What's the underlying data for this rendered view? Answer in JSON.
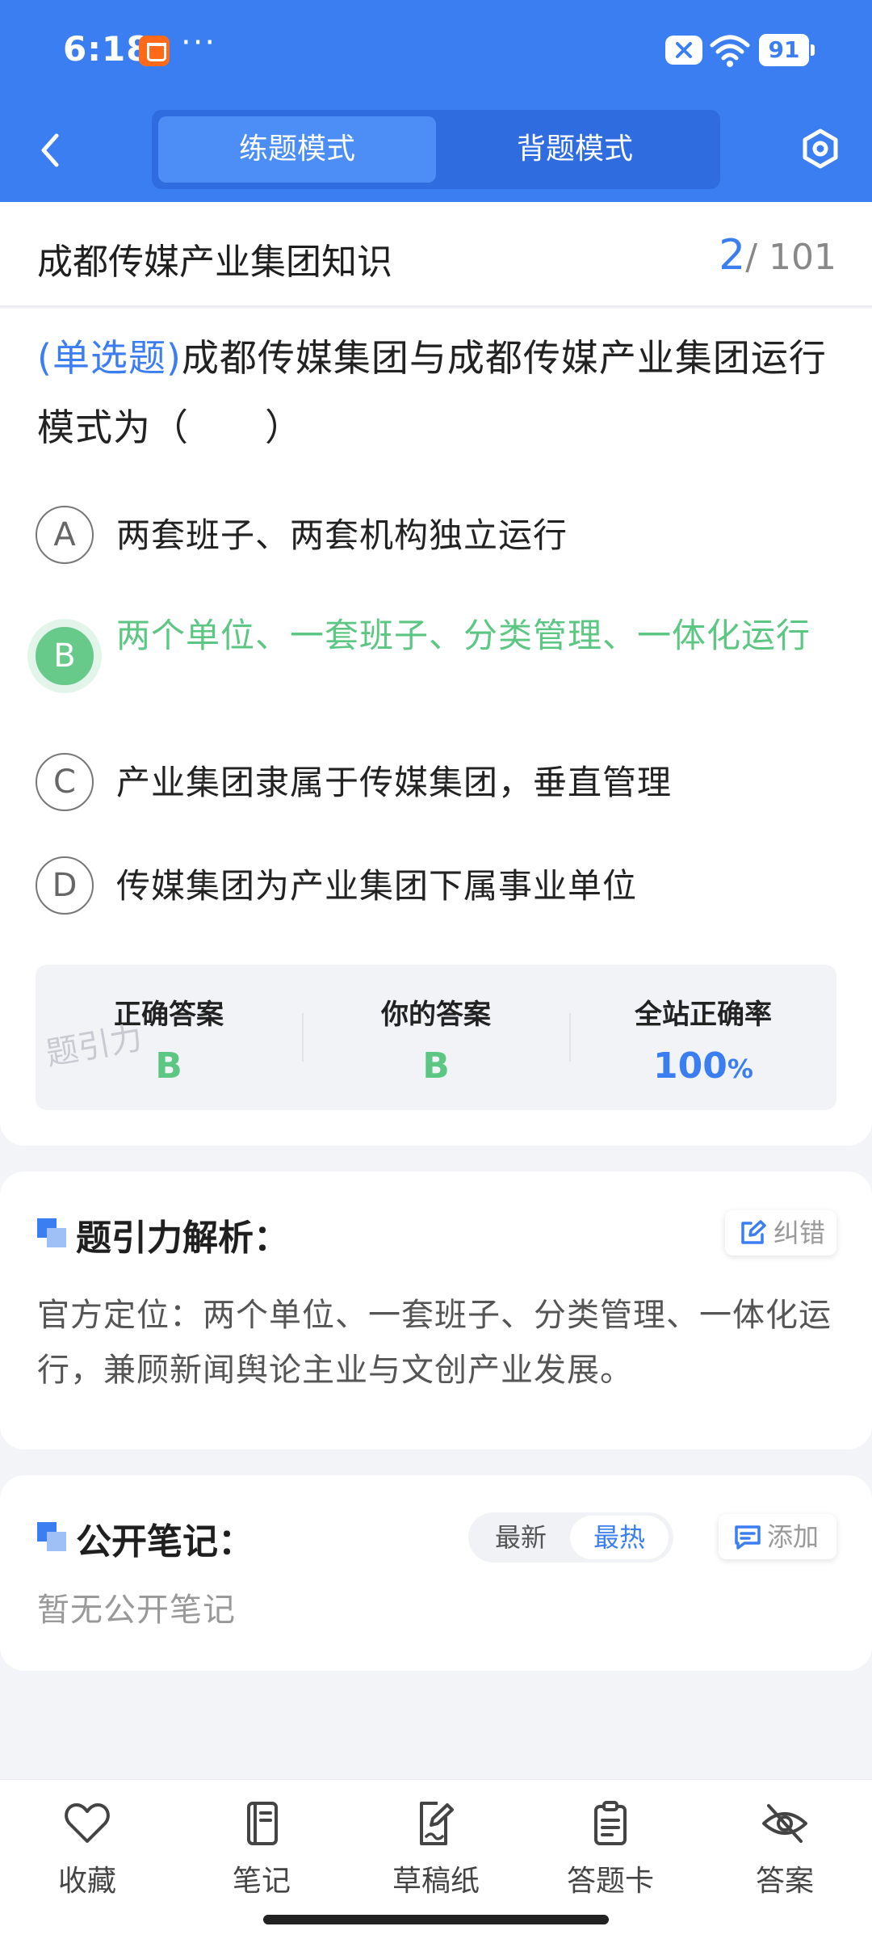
{
  "status_bar": {
    "time": "6:18",
    "dots": "···",
    "battery": "91",
    "icons": [
      "shopping-bag-icon",
      "close-badge-icon",
      "wifi-icon",
      "battery-icon"
    ]
  },
  "header": {
    "tabs": [
      {
        "label": "练题模式",
        "active": true
      },
      {
        "label": "背题模式",
        "active": false
      }
    ],
    "colors": {
      "primary": "#3b7ef1",
      "correct": "#5cc783"
    }
  },
  "title_bar": {
    "title": "成都传媒产业集团知识",
    "current": "2",
    "total": "/ 101"
  },
  "question": {
    "type": "(单选题)",
    "text": "成都传媒集团与成都传媒产业集团运行模式为（　　）",
    "options": [
      {
        "letter": "A",
        "text": "两套班子、两套机构独立运行"
      },
      {
        "letter": "B",
        "text": "两个单位、一套班子、分类管理、一体化运行"
      },
      {
        "letter": "C",
        "text": "产业集团隶属于传媒集团，垂直管理"
      },
      {
        "letter": "D",
        "text": "传媒集团为产业集团下属事业单位"
      }
    ]
  },
  "answer_summary": {
    "correct_label": "正确答案",
    "correct_value": "B",
    "yours_label": "你的答案",
    "yours_value": "B",
    "rate_label": "全站正确率",
    "rate_value": "100",
    "rate_unit": "%",
    "watermark": "题引力"
  },
  "analysis": {
    "title": "题引力解析：",
    "correct_button": "纠错",
    "body": "官方定位：两个单位、一套班子、分类管理、一体化运行，兼顾新闻舆论主业与文创产业发展。"
  },
  "notes": {
    "title": "公开笔记：",
    "sort_latest": "最新",
    "sort_hot": "最热",
    "add_button": "添加",
    "empty_text": "暂无公开笔记"
  },
  "bottom_nav": [
    {
      "label": "收藏",
      "icon": "heart-icon"
    },
    {
      "label": "笔记",
      "icon": "notebook-icon"
    },
    {
      "label": "草稿纸",
      "icon": "draft-paper-icon"
    },
    {
      "label": "答题卡",
      "icon": "answer-sheet-icon"
    },
    {
      "label": "答案",
      "icon": "eye-off-icon"
    }
  ]
}
